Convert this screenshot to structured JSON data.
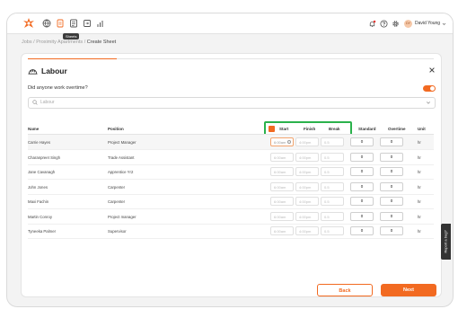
{
  "nav": {
    "tooltip": "Sheets",
    "user_initials": "DY",
    "user_name": "David Young"
  },
  "breadcrumb": {
    "jobs": "Jobs",
    "sep1": " / ",
    "project": "Proximity Apartments",
    "sep2": " / ",
    "current": "Create Sheet"
  },
  "card": {
    "title": "Labour",
    "overtime_question": "Did anyone work overtime?",
    "overtime_on": true,
    "progress": 0.22,
    "search_placeholder": "Labour"
  },
  "table": {
    "headers": {
      "name": "Name",
      "position": "Position",
      "start": "Start",
      "finish": "Finish",
      "break": "Break",
      "standard": "Standard",
      "overtime": "Overtime",
      "unit": "Unit"
    },
    "rows": [
      {
        "name": "Carrie Hayes",
        "position": "Project Manager",
        "start": "6:00am",
        "finish": "4:00pm",
        "break": "0.5",
        "standard": "0",
        "overtime": "0",
        "unit": "hr"
      },
      {
        "name": "Charanpreet Singh",
        "position": "Trade Assistant",
        "start": "6:00am",
        "finish": "4:00pm",
        "break": "0.5",
        "standard": "0",
        "overtime": "0",
        "unit": "hr"
      },
      {
        "name": "Jane Cavanagh",
        "position": "Apprentice Yr2",
        "start": "6:00am",
        "finish": "4:00pm",
        "break": "0.5",
        "standard": "0",
        "overtime": "0",
        "unit": "hr"
      },
      {
        "name": "John Jones",
        "position": "Carpenter",
        "start": "6:00am",
        "finish": "4:00pm",
        "break": "0.5",
        "standard": "0",
        "overtime": "0",
        "unit": "hr"
      },
      {
        "name": "Maxi Fachin",
        "position": "Carpenter",
        "start": "6:00am",
        "finish": "4:00pm",
        "break": "0.5",
        "standard": "0",
        "overtime": "0",
        "unit": "hr"
      },
      {
        "name": "Martin Conroy",
        "position": "Project manager",
        "start": "6:00am",
        "finish": "4:00pm",
        "break": "0.5",
        "standard": "0",
        "overtime": "0",
        "unit": "hr"
      },
      {
        "name": "Tyneeka Palmer",
        "position": "Supervisor",
        "start": "6:00am",
        "finish": "4:00pm",
        "break": "0.5",
        "standard": "0",
        "overtime": "0",
        "unit": "hr"
      }
    ]
  },
  "buttons": {
    "back": "Back",
    "next": "Next"
  },
  "feedback_label": "Report a bug?",
  "colors": {
    "accent": "#f26a21",
    "highlight": "#2bb24c"
  }
}
